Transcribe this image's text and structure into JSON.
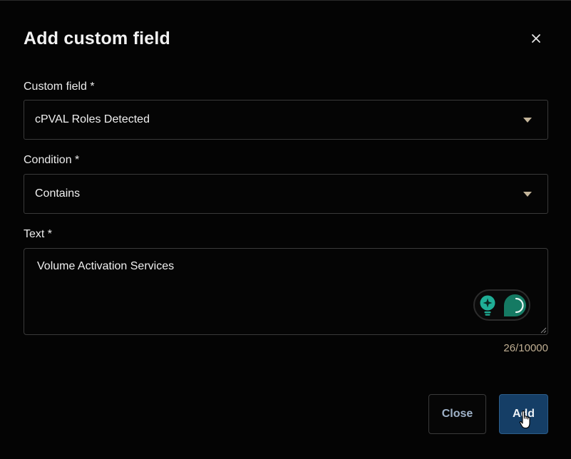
{
  "dialog": {
    "title": "Add custom field",
    "close_icon": "close-icon"
  },
  "custom_field": {
    "label": "Custom field *",
    "value": "cPVAL Roles Detected",
    "icon": "caret-down-icon"
  },
  "condition": {
    "label": "Condition *",
    "value": "Contains",
    "icon": "caret-down-icon"
  },
  "text_field": {
    "label": "Text *",
    "value": "Volume Activation Services",
    "counter": "26/10000",
    "assist_icons": [
      "lightbulb-sparkle-icon",
      "chat-bubble-icon"
    ]
  },
  "footer": {
    "close_label": "Close",
    "add_label": "Add"
  },
  "colors": {
    "background": "#040404",
    "primary_button": "#153e66",
    "accent_teal": "#1fae96",
    "counter_text": "#bfae92"
  }
}
